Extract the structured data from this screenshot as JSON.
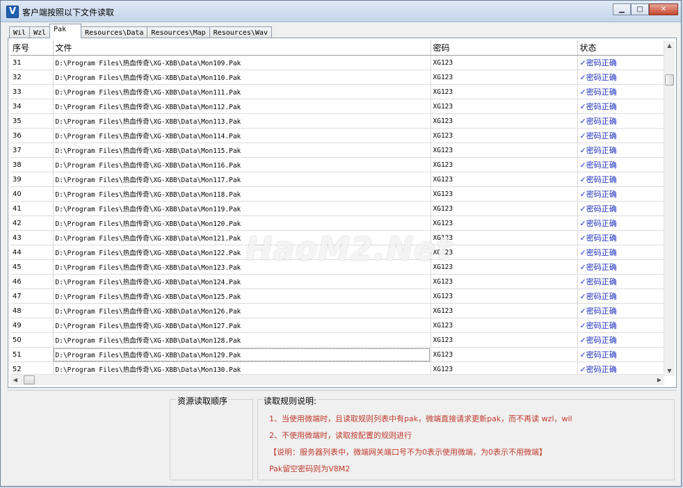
{
  "window": {
    "title": "客户端按照以下文件读取",
    "icon": "V",
    "caption_buttons": {
      "minimize": "▁",
      "maximize": "□",
      "close": "✕"
    }
  },
  "tabs": [
    {
      "label": "Wil",
      "active": false
    },
    {
      "label": "Wzl",
      "active": false
    },
    {
      "label": "Pak",
      "active": true
    },
    {
      "label": "Resources\\Data",
      "active": false
    },
    {
      "label": "Resources\\Map",
      "active": false
    },
    {
      "label": "Resources\\Wav",
      "active": false
    }
  ],
  "table": {
    "columns": [
      "序号",
      "文件",
      "密码",
      "状态"
    ],
    "rows": [
      {
        "no": "31",
        "file": "D:\\Program Files\\热血传奇\\XG-XBB\\Data\\Mon109.Pak",
        "pw": "XG123",
        "status": "✓密码正确"
      },
      {
        "no": "32",
        "file": "D:\\Program Files\\热血传奇\\XG-XBB\\Data\\Mon110.Pak",
        "pw": "XG123",
        "status": "✓密码正确"
      },
      {
        "no": "33",
        "file": "D:\\Program Files\\热血传奇\\XG-XBB\\Data\\Mon111.Pak",
        "pw": "XG123",
        "status": "✓密码正确"
      },
      {
        "no": "34",
        "file": "D:\\Program Files\\热血传奇\\XG-XBB\\Data\\Mon112.Pak",
        "pw": "XG123",
        "status": "✓密码正确"
      },
      {
        "no": "35",
        "file": "D:\\Program Files\\热血传奇\\XG-XBB\\Data\\Mon113.Pak",
        "pw": "XG123",
        "status": "✓密码正确"
      },
      {
        "no": "36",
        "file": "D:\\Program Files\\热血传奇\\XG-XBB\\Data\\Mon114.Pak",
        "pw": "XG123",
        "status": "✓密码正确"
      },
      {
        "no": "37",
        "file": "D:\\Program Files\\热血传奇\\XG-XBB\\Data\\Mon115.Pak",
        "pw": "XG123",
        "status": "✓密码正确"
      },
      {
        "no": "38",
        "file": "D:\\Program Files\\热血传奇\\XG-XBB\\Data\\Mon116.Pak",
        "pw": "XG123",
        "status": "✓密码正确"
      },
      {
        "no": "39",
        "file": "D:\\Program Files\\热血传奇\\XG-XBB\\Data\\Mon117.Pak",
        "pw": "XG123",
        "status": "✓密码正确"
      },
      {
        "no": "40",
        "file": "D:\\Program Files\\热血传奇\\XG-XBB\\Data\\Mon118.Pak",
        "pw": "XG123",
        "status": "✓密码正确"
      },
      {
        "no": "41",
        "file": "D:\\Program Files\\热血传奇\\XG-XBB\\Data\\Mon119.Pak",
        "pw": "XG123",
        "status": "✓密码正确"
      },
      {
        "no": "42",
        "file": "D:\\Program Files\\热血传奇\\XG-XBB\\Data\\Mon120.Pak",
        "pw": "XG123",
        "status": "✓密码正确"
      },
      {
        "no": "43",
        "file": "D:\\Program Files\\热血传奇\\XG-XBB\\Data\\Mon121.Pak",
        "pw": "XG123",
        "status": "✓密码正确"
      },
      {
        "no": "44",
        "file": "D:\\Program Files\\热血传奇\\XG-XBB\\Data\\Mon122.Pak",
        "pw": "XG123",
        "status": "✓密码正确"
      },
      {
        "no": "45",
        "file": "D:\\Program Files\\热血传奇\\XG-XBB\\Data\\Mon123.Pak",
        "pw": "XG123",
        "status": "✓密码正确"
      },
      {
        "no": "46",
        "file": "D:\\Program Files\\热血传奇\\XG-XBB\\Data\\Mon124.Pak",
        "pw": "XG123",
        "status": "✓密码正确"
      },
      {
        "no": "47",
        "file": "D:\\Program Files\\热血传奇\\XG-XBB\\Data\\Mon125.Pak",
        "pw": "XG123",
        "status": "✓密码正确"
      },
      {
        "no": "48",
        "file": "D:\\Program Files\\热血传奇\\XG-XBB\\Data\\Mon126.Pak",
        "pw": "XG123",
        "status": "✓密码正确"
      },
      {
        "no": "49",
        "file": "D:\\Program Files\\热血传奇\\XG-XBB\\Data\\Mon127.Pak",
        "pw": "XG123",
        "status": "✓密码正确"
      },
      {
        "no": "50",
        "file": "D:\\Program Files\\热血传奇\\XG-XBB\\Data\\Mon128.Pak",
        "pw": "XG123",
        "status": "✓密码正确"
      },
      {
        "no": "51",
        "file": "D:\\Program Files\\热血传奇\\XG-XBB\\Data\\Mon129.Pak",
        "pw": "XG123",
        "status": "✓密码正确",
        "selected": true
      },
      {
        "no": "52",
        "file": "D:\\Program Files\\热血传奇\\XG-XBB\\Data\\Mon130.Pak",
        "pw": "XG123",
        "status": "✓密码正确"
      }
    ]
  },
  "scrollbars": {
    "up": "▲",
    "down": "▼",
    "left": "◀",
    "right": "▶"
  },
  "bottom": {
    "order_title": "资源读取顺序",
    "rules_title": "读取规则说明:",
    "rules": [
      "1、当使用微端时，且读取规则列表中有pak，微端直接请求更新pak，而不再读 wzl，wil",
      "2、不使用微端时，读取按配置的规则进行",
      "【说明：服务器列表中，微端网关端口号不为0表示使用微端，为0表示不用微端】",
      "Pak留空密码则为V8M2"
    ]
  },
  "watermark": "HaoM2.Net",
  "colors": {
    "status": "#1c2fbf",
    "rules": "#c0392b",
    "titlebar": "#c4d5ea"
  }
}
